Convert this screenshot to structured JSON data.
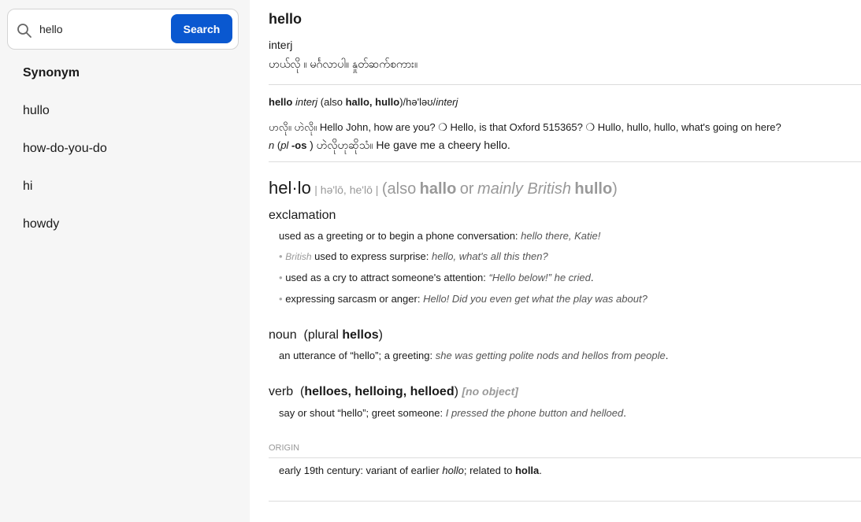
{
  "search": {
    "value": "hello",
    "button_label": "Search"
  },
  "sidebar": {
    "heading": "Synonym",
    "items": [
      "hullo",
      "how-do-you-do",
      "hi",
      "howdy"
    ]
  },
  "entry1": {
    "headword": "hello",
    "pos": "interj",
    "definition": "ဟယ်လို ။ မင်္ဂလာပါ။ နှုတ်ဆက်စကား။"
  },
  "entry2": {
    "headword": "hello",
    "pos": "interj",
    "also_open": "(also",
    "also_words": "hallo, hullo",
    "pron": ")/hə'ləʊ/",
    "pos2": "interj",
    "line1": "ဟလို။ ဟဲလို။ Hello John, how are you? ❍ Hello, is that Oxford 515365? ❍ Hullo, hullo, hullo, what's going on here?",
    "n": "n",
    "pl_open": "(",
    "pl": "pl",
    "pl_suffix": "-os",
    "line2_tail": ") ဟဲလိုဟုဆိုသံ။ He gave me a cheery hello."
  },
  "entry3": {
    "headword": "hel·lo",
    "pron": "| hə'lō, he'lō |",
    "also_open": "(also",
    "also_word1": "hallo",
    "also_or": "or",
    "also_region": "mainly British",
    "also_word2": "hullo",
    "also_close": ")",
    "exclamation": {
      "label": "exclamation",
      "senses": [
        {
          "bullet": "",
          "register": "",
          "text": "used as a greeting or to begin a phone conversation:",
          "example": "hello there, Katie!"
        },
        {
          "bullet": "•",
          "register": "British",
          "text": "used to express surprise:",
          "example": "hello, what's all this then?"
        },
        {
          "bullet": "•",
          "register": "",
          "text": "used as a cry to attract someone's attention:",
          "example": "“Hello below!” he cried",
          "end": "."
        },
        {
          "bullet": "•",
          "register": "",
          "text": "expressing sarcasm or anger:",
          "example": "Hello! Did you even get what the play was about?"
        }
      ]
    },
    "noun": {
      "label": "noun",
      "plural_open": "(plural",
      "plural_word": "hellos",
      "plural_close": ")",
      "text": "an utterance of “hello”; a greeting:",
      "example": "she was getting polite nods and hellos from people",
      "end": "."
    },
    "verb": {
      "label": "verb",
      "forms_open": "(",
      "forms": "helloes, helloing, helloed",
      "forms_close": ")",
      "object": "[no object]",
      "text": "say or shout “hello”; greet someone:",
      "example": "I pressed the phone button and helloed",
      "end": "."
    },
    "origin": {
      "label": "ORIGIN",
      "text1": "early 19th century: variant of earlier",
      "word1": "hollo",
      "text2": "; related to",
      "word2": "holla",
      "end": "."
    }
  },
  "colors": {
    "accent": "#0a58d0",
    "sidebar_bg": "#f6f6f6",
    "muted": "#999999"
  },
  "icons": {
    "search": "magnifier"
  }
}
